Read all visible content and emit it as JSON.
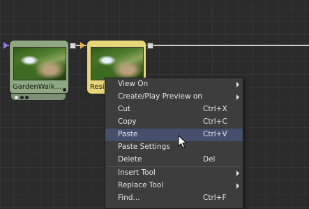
{
  "nodes": [
    {
      "label": "GardenWalk...",
      "color": "#8fa884"
    },
    {
      "label": "Resi",
      "color": "#e8d67a"
    }
  ],
  "menu": {
    "items": [
      {
        "label": "View On",
        "shortcut": "",
        "submenu": true
      },
      {
        "label": "Create/Play Preview on",
        "shortcut": "",
        "submenu": true
      },
      {
        "label": "Cut",
        "shortcut": "Ctrl+X",
        "submenu": false
      },
      {
        "label": "Copy",
        "shortcut": "Ctrl+C",
        "submenu": false
      },
      {
        "label": "Paste",
        "shortcut": "Ctrl+V",
        "submenu": false,
        "highlighted": true
      },
      {
        "label": "Paste Settings",
        "shortcut": "",
        "submenu": false
      },
      {
        "label": "Delete",
        "shortcut": "Del",
        "submenu": false
      },
      {
        "label": "Insert Tool",
        "shortcut": "",
        "submenu": true
      },
      {
        "label": "Replace Tool",
        "shortcut": "",
        "submenu": true
      },
      {
        "label": "Find...",
        "shortcut": "Ctrl+F",
        "submenu": false
      }
    ],
    "highlight_color": "#44506b"
  },
  "colors": {
    "background": "#2b2b2b",
    "menu_background": "#3d3d3d",
    "port_input": "#8a7ee6",
    "port_input_alt": "#f2b23b"
  }
}
